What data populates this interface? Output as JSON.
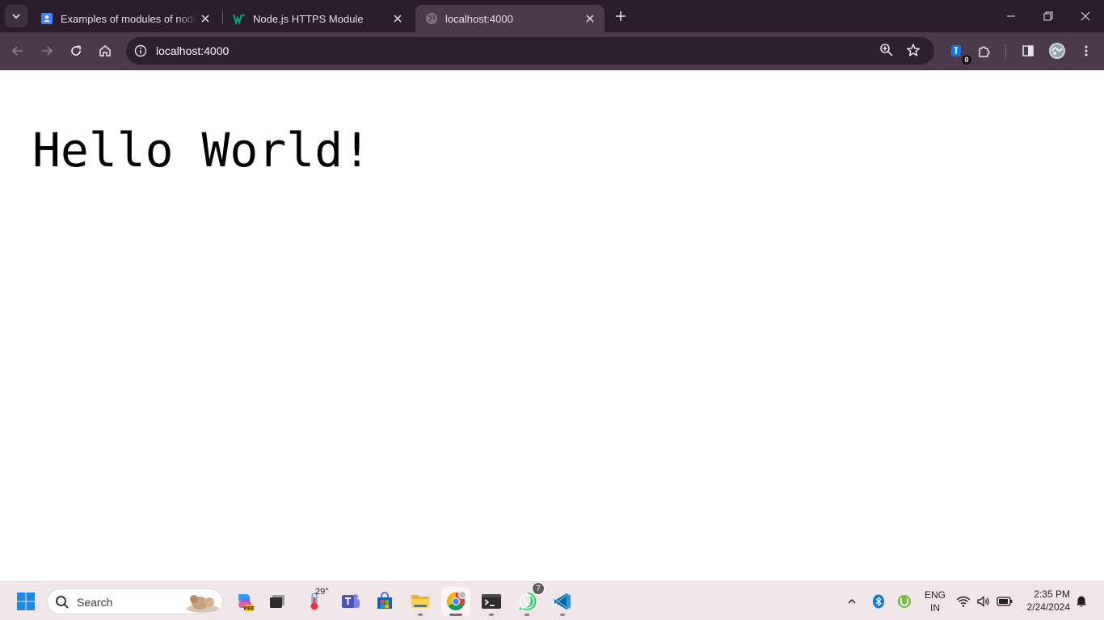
{
  "browser": {
    "tabs": [
      {
        "title": "Examples of modules of node js",
        "favicon": "google-docs-icon",
        "active": false
      },
      {
        "title": "Node.js HTTPS Module",
        "favicon": "w3schools-icon",
        "active": false
      },
      {
        "title": "localhost:4000",
        "favicon": "globe-icon",
        "active": true
      }
    ],
    "address": "localhost:4000",
    "extension_badge": "0"
  },
  "page": {
    "heading": "Hello World!"
  },
  "taskbar": {
    "search_label": "Search",
    "weather_temp": "29°",
    "whatsapp_badge": "7",
    "language": "ENG",
    "region": "IN",
    "time": "2:35 PM",
    "date": "2/24/2024"
  },
  "colors": {
    "titlebar": "#2a1c2c",
    "toolbar": "#4a3a4c",
    "omnibox": "#2c1f2e",
    "taskbar": "#f1e6ea"
  }
}
